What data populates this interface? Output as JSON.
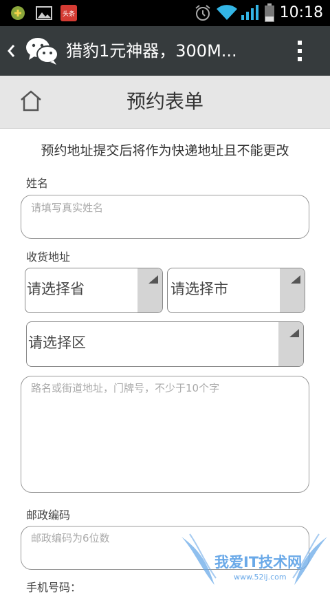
{
  "status_bar": {
    "time": "10:18",
    "icons": [
      "android-notification-icon",
      "picture-icon",
      "news-app-icon",
      "alarm-icon",
      "wifi-icon",
      "signal-icon",
      "battery-icon"
    ],
    "news_app_label": "头条"
  },
  "action_bar": {
    "title": "猎豹1元神器，300M...",
    "icons": [
      "back-chevron-icon",
      "wechat-icon",
      "overflow-menu-icon"
    ]
  },
  "header": {
    "title": "预约表单",
    "home_icon": "home-icon"
  },
  "form": {
    "notice": "预约地址提交后将作为快递地址且不能更改",
    "name_label": "姓名",
    "name_placeholder": "请填写真实姓名",
    "address_label": "收货地址",
    "province_value": "请选择省",
    "city_value": "请选择市",
    "district_value": "请选择区",
    "street_placeholder": "路名或街道地址，门牌号，不少于10个字",
    "postcode_label": "邮政编码",
    "postcode_placeholder": "邮政编码为6位数",
    "phone_label": "手机号码："
  },
  "watermark": {
    "text": "我爱IT技术网",
    "url": "www.52ij.com"
  },
  "colors": {
    "status_bar": "#000000",
    "action_bar": "#363b3d",
    "header_bg": "#e6e6e6",
    "wifi_signal": "#33b5e5",
    "watermark": "#6aa9e8"
  }
}
